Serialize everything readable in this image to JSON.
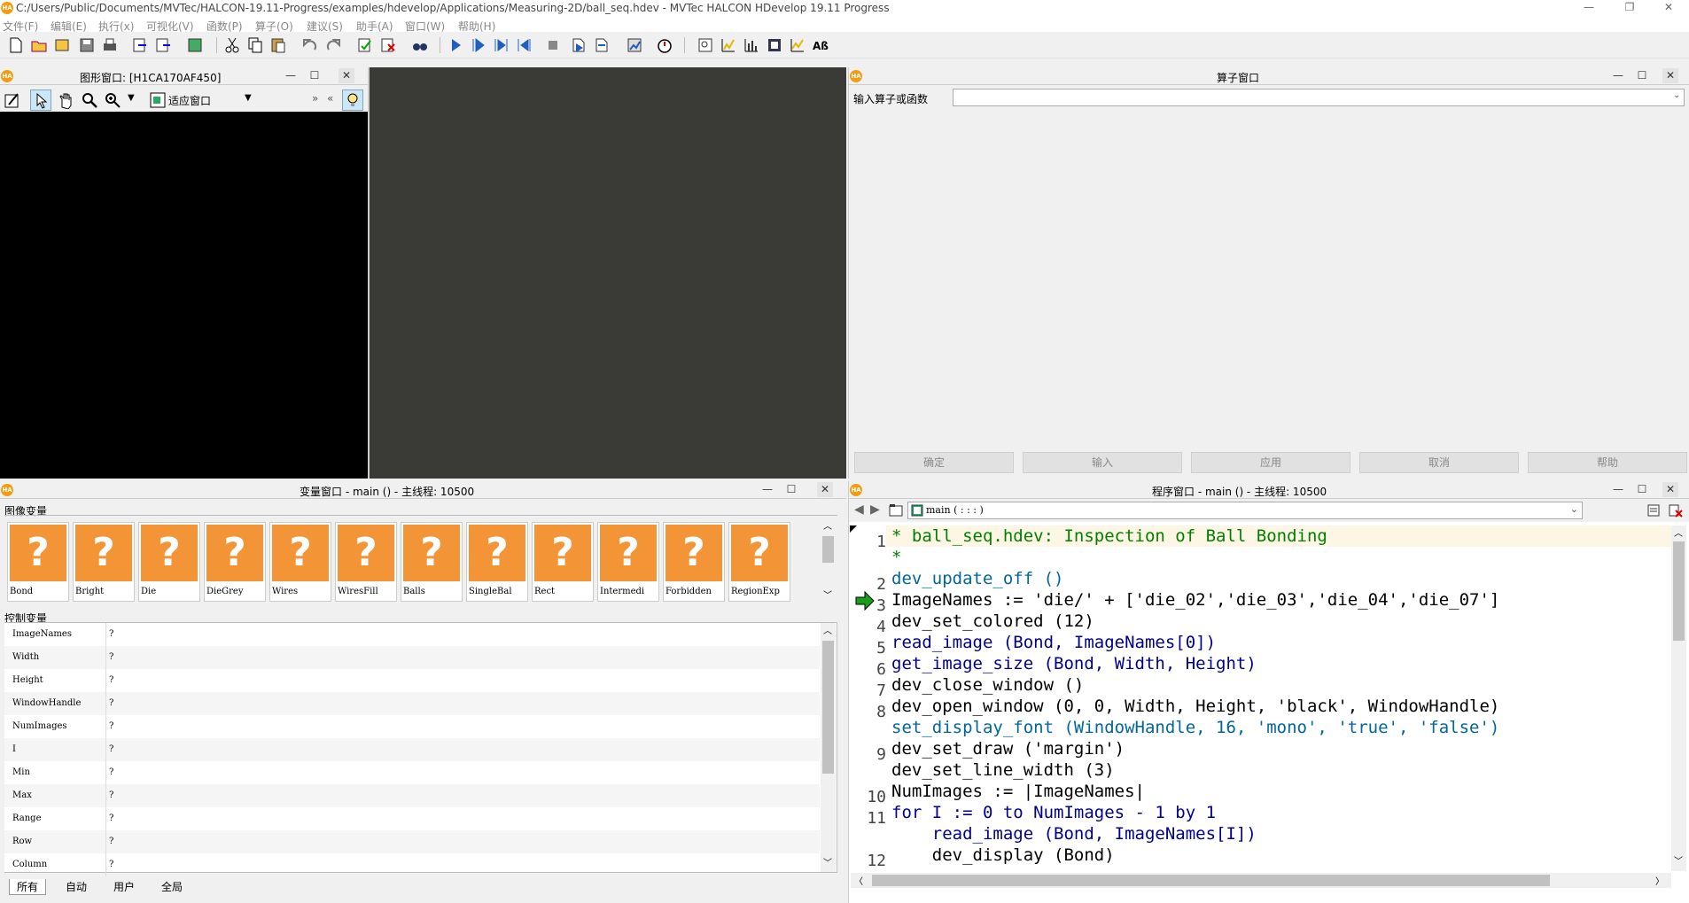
{
  "window": {
    "title": "C:/Users/Public/Documents/MVTec/HALCON-19.11-Progress/examples/hdevelop/Applications/Measuring-2D/ball_seq.hdev - MVTec HALCON HDevelop 19.11 Progress",
    "logo": "HA",
    "min": "—",
    "max": "❐",
    "close": "✕"
  },
  "menu": [
    "文件(F)",
    "编辑(E)",
    "执行(x)",
    "可视化(V)",
    "函数(P)",
    "算子(O)",
    "建议(S)",
    "助手(A)",
    "窗口(W)",
    "帮助(H)"
  ],
  "graphics_window": {
    "title": "图形窗口: [H1CA170AF450]",
    "fit_label": "适应窗口",
    "more": "»",
    "back": "«"
  },
  "operator_window": {
    "title": "算子窗口",
    "input_label": "输入算子或函数",
    "input_value": "",
    "buttons": [
      "确定",
      "输入",
      "应用",
      "取消",
      "帮助"
    ]
  },
  "variable_window": {
    "title": "变量窗口 - main () - 主线程: 10500",
    "image_group_label": "图像变量",
    "control_group_label": "控制变量",
    "image_vars": [
      "Bond",
      "Bright",
      "Die",
      "DieGrey",
      "Wires",
      "WiresFill",
      "Balls",
      "SingleBal",
      "Rect",
      "Intermedi",
      "Forbidden",
      "RegionExp"
    ],
    "image_placeholder": "?",
    "control_vars": [
      {
        "name": "ImageNames",
        "value": "?"
      },
      {
        "name": "Width",
        "value": "?"
      },
      {
        "name": "Height",
        "value": "?"
      },
      {
        "name": "WindowHandle",
        "value": "?"
      },
      {
        "name": "NumImages",
        "value": "?"
      },
      {
        "name": "I",
        "value": "?"
      },
      {
        "name": "Min",
        "value": "?"
      },
      {
        "name": "Max",
        "value": "?"
      },
      {
        "name": "Range",
        "value": "?"
      },
      {
        "name": "Row",
        "value": "?"
      },
      {
        "name": "Column",
        "value": "?"
      }
    ],
    "tabs": [
      "所有",
      "自动",
      "用户",
      "全局"
    ]
  },
  "program_window": {
    "title": "程序窗口 - main () - 主线程: 10500",
    "procedure": "main ( : : : )",
    "current_line": 3,
    "lines": [
      {
        "n": "1",
        "text": "* ball_seq.hdev: Inspection of Ball Bonding",
        "cls": "kw-g"
      },
      {
        "n": "",
        "text": "*",
        "cls": "kw-g"
      },
      {
        "n": "2",
        "text": "dev_update_off ()",
        "cls": "kw-c"
      },
      {
        "n": "3",
        "text": "ImageNames := 'die/' + ['die_02','die_03','die_04','die_07']",
        "cls": "str"
      },
      {
        "n": "4",
        "text": "dev_set_colored (12)",
        "cls": "str"
      },
      {
        "n": "5",
        "text": "read_image (Bond, ImageNames[0])",
        "cls": "kw-b"
      },
      {
        "n": "6",
        "text": "get_image_size (Bond, Width, Height)",
        "cls": "kw-b"
      },
      {
        "n": "7",
        "text": "dev_close_window ()",
        "cls": "str"
      },
      {
        "n": "8",
        "text": "dev_open_window (0, 0, Width, Height, 'black', WindowHandle)",
        "cls": "str"
      },
      {
        "n": "",
        "text": "set_display_font (WindowHandle, 16, 'mono', 'true', 'false')",
        "cls": "kw-c"
      },
      {
        "n": "9",
        "text": "dev_set_draw ('margin')",
        "cls": "str"
      },
      {
        "n": "",
        "text": "dev_set_line_width (3)",
        "cls": "str"
      },
      {
        "n": "10",
        "text": "NumImages := |ImageNames|",
        "cls": "str"
      },
      {
        "n": "11",
        "text": "for I := 0 to NumImages - 1 by 1",
        "cls": "kw-b"
      },
      {
        "n": "",
        "text": "    read_image (Bond, ImageNames[I])",
        "cls": "kw-b"
      },
      {
        "n": "12",
        "text": "    dev_display (Bond)",
        "cls": "str"
      }
    ]
  },
  "colors": {
    "accent_orange": "#f39436",
    "canvas_black": "#000000",
    "dark_area": "#3a3a37",
    "pc_arrow_green": "#1a9e1a"
  }
}
